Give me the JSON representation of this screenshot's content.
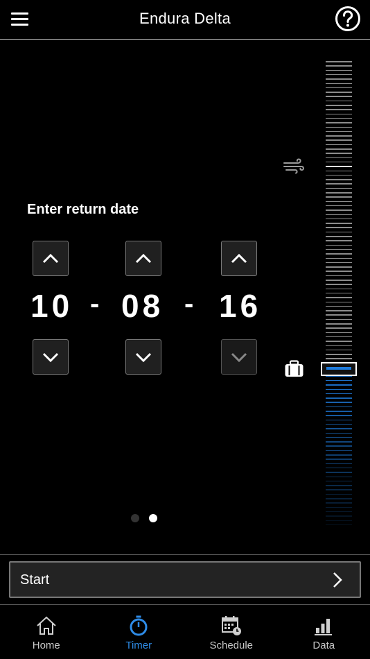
{
  "header": {
    "title": "Endura Delta"
  },
  "form": {
    "label": "Enter return date",
    "month": "10",
    "day": "08",
    "year": "16",
    "separator": "-"
  },
  "slider": {
    "level": 0.35
  },
  "pager": {
    "total": 2,
    "current": 2
  },
  "start": {
    "label": "Start"
  },
  "tabs": [
    {
      "label": "Home",
      "icon": "home-icon"
    },
    {
      "label": "Timer",
      "icon": "timer-icon",
      "active": true
    },
    {
      "label": "Schedule",
      "icon": "schedule-icon"
    },
    {
      "label": "Data",
      "icon": "data-icon"
    }
  ],
  "colors": {
    "accent": "#1e7bdc",
    "background": "#000000"
  }
}
